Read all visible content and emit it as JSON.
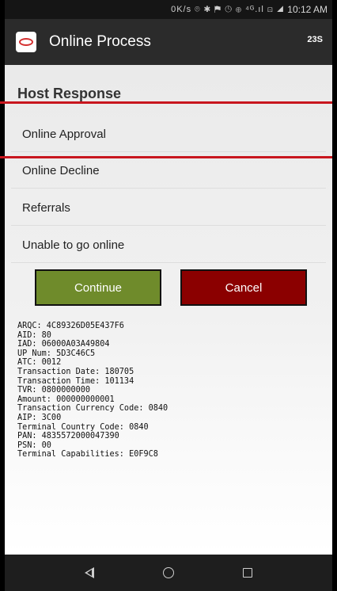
{
  "status_bar": {
    "indicators": "0K/s ⌾ ✱ ⚑ ◷ ⊛ ⁴ᴳ.ıl ⊡ ◢",
    "time": "10:12 AM"
  },
  "app_bar": {
    "title": "Online Process",
    "counter": "23S",
    "logo_icon": "app-logo-icon"
  },
  "host_response": {
    "title": "Host Response",
    "options": [
      {
        "label": "Online Approval",
        "highlighted": true
      },
      {
        "label": "Online Decline"
      },
      {
        "label": "Referrals"
      },
      {
        "label": "Unable to go online"
      }
    ]
  },
  "buttons": {
    "continue_label": "Continue",
    "cancel_label": "Cancel",
    "continue_color": "#6f8b2b",
    "cancel_color": "#8b0000"
  },
  "details": [
    "ARQC: 4C89326D05E437F6",
    "AID: 80",
    "IAD: 06000A03A49804",
    "UP Num: 5D3C46C5",
    "ATC: 0012",
    "Transaction Date: 180705",
    "Transaction Time: 101134",
    "TVR: 0800000000",
    "Amount: 000000000001",
    "Transaction Currency Code: 0840",
    "AIP: 3C00",
    "Terminal Country Code: 0840",
    "PAN: 4835572000047390",
    "PSN: 00",
    "Terminal Capabilities: E0F9C8"
  ],
  "highlight_color": "#c8161e",
  "nav": {
    "back_icon": "back-triangle-icon",
    "home_icon": "home-circle-icon",
    "recents_icon": "recents-square-icon"
  }
}
